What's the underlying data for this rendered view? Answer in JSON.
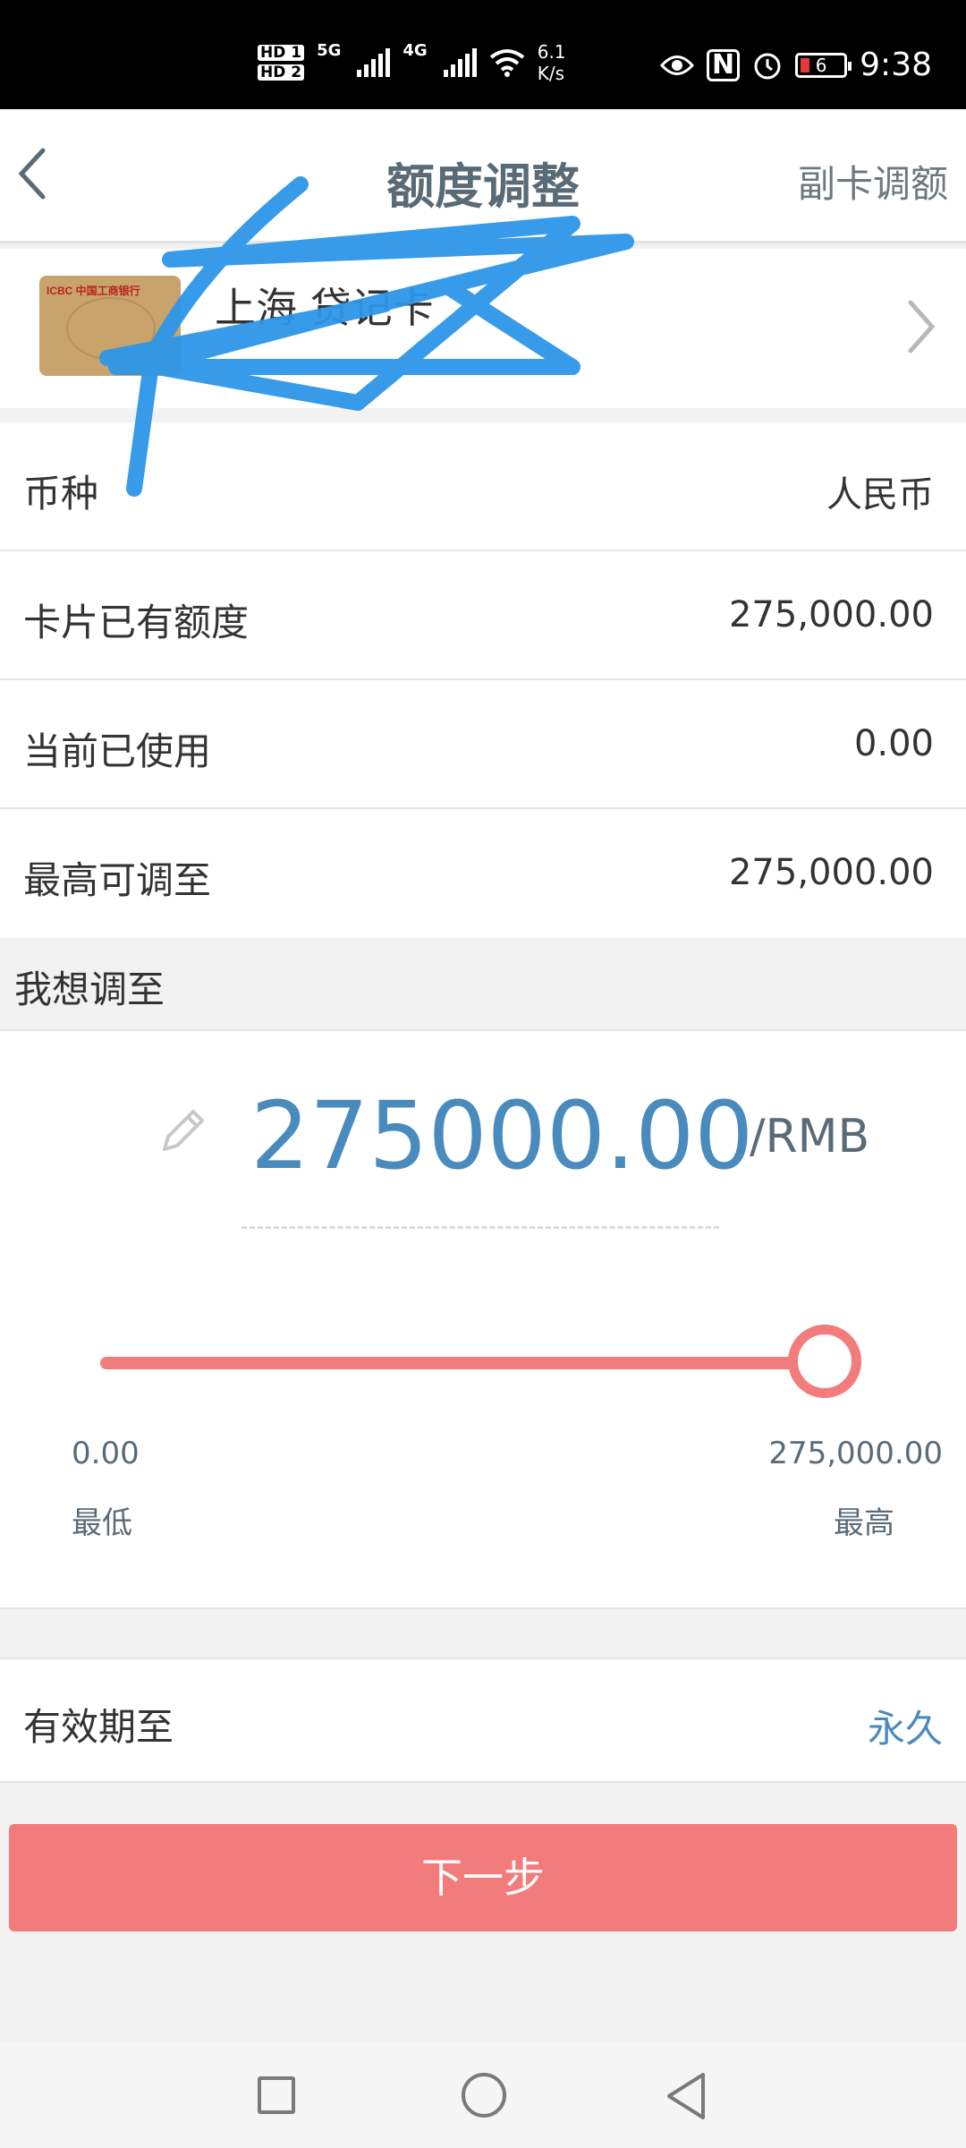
{
  "status_bar": {
    "hd1": "HD 1",
    "hd2": "HD 2",
    "net1": "5G",
    "net2": "4G",
    "speed_value": "6.1",
    "speed_unit": "K/s",
    "battery": "6",
    "time": "9:38"
  },
  "header": {
    "title": "额度调整",
    "action": "副卡调额"
  },
  "card": {
    "name": "上海 贷记卡",
    "logo": "ICBC 中国工商银行"
  },
  "info": {
    "currency_label": "币种",
    "currency_value": "人民币",
    "existing_label": "卡片已有额度",
    "existing_value": "275,000.00",
    "used_label": "当前已使用",
    "used_value": "0.00",
    "max_label": "最高可调至",
    "max_value": "275,000.00"
  },
  "adjust": {
    "section_label": "我想调至",
    "amount": "275000.00",
    "unit": "/RMB",
    "slider_min_value": "0.00",
    "slider_max_value": "275,000.00",
    "slider_min_label": "最低",
    "slider_max_label": "最高",
    "slider_position_fraction": 1.0
  },
  "validity": {
    "label": "有效期至",
    "value": "永久"
  },
  "actions": {
    "next": "下一步"
  },
  "colors": {
    "accent_blue": "#4a8bbd",
    "accent_red": "#f27b7b",
    "scribble_blue": "#2d96e8"
  }
}
